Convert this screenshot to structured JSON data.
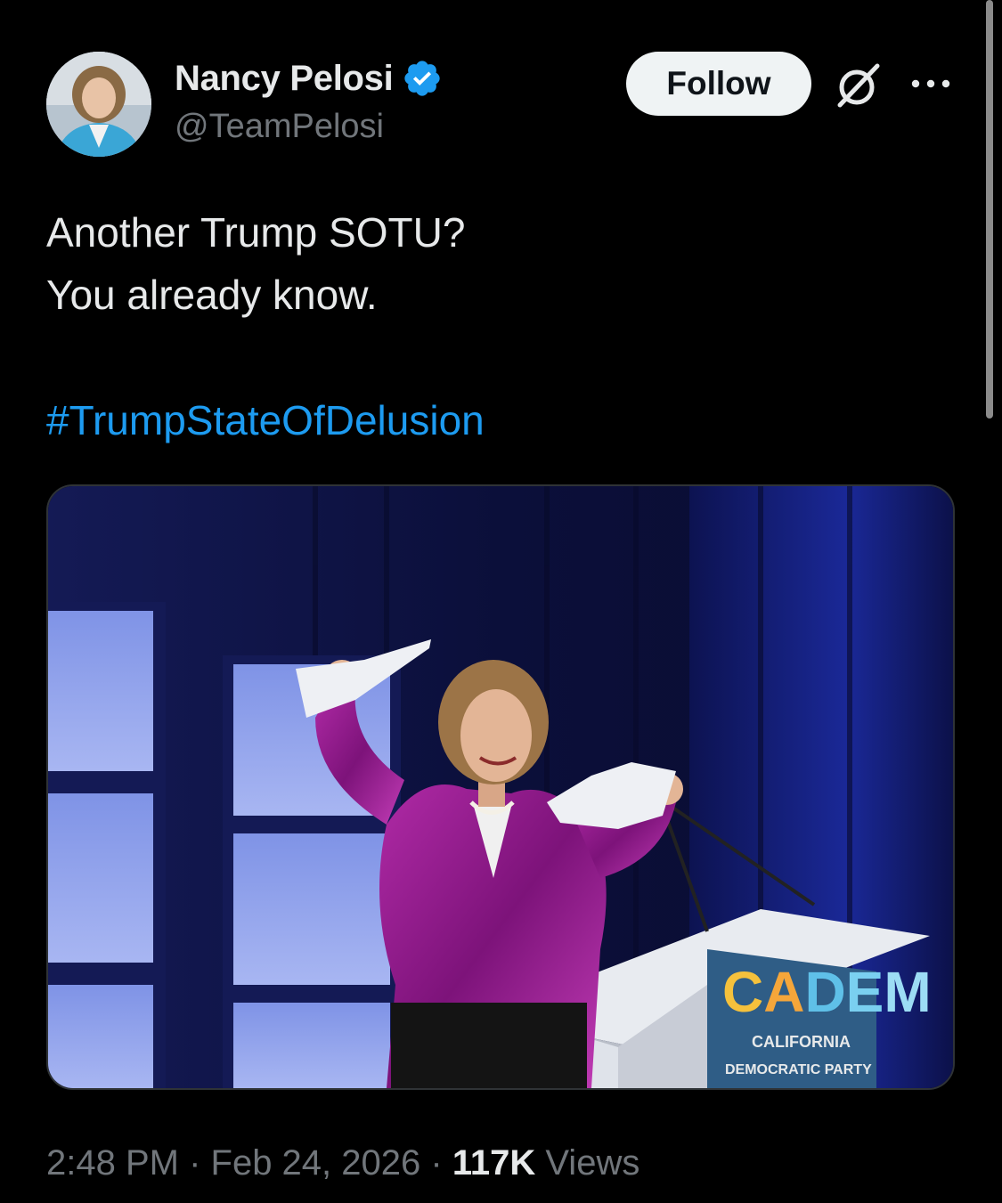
{
  "author": {
    "name": "Nancy Pelosi",
    "handle": "@TeamPelosi",
    "verified": true
  },
  "header": {
    "follow_label": "Follow",
    "grok_icon": "grok-icon",
    "more_icon": "more-options-icon"
  },
  "tweet": {
    "lines": [
      "Another Trump SOTU?",
      "You already know."
    ],
    "hashtag": "#TrumpStateOfDelusion"
  },
  "media": {
    "podium_logo": "CADEM",
    "podium_subtitle": "CALIFORNIA",
    "podium_subtitle2": "DEMOCRATIC PARTY"
  },
  "meta": {
    "time": "2:48 PM",
    "separator": " · ",
    "date": "Feb 24, 2026",
    "views_count": "117K",
    "views_label": " Views"
  },
  "colors": {
    "background": "#000000",
    "text": "#e7e9ea",
    "secondary": "#71767b",
    "link": "#1d9bf0",
    "verified": "#1d9bf0",
    "follow_bg": "#eff3f4"
  }
}
